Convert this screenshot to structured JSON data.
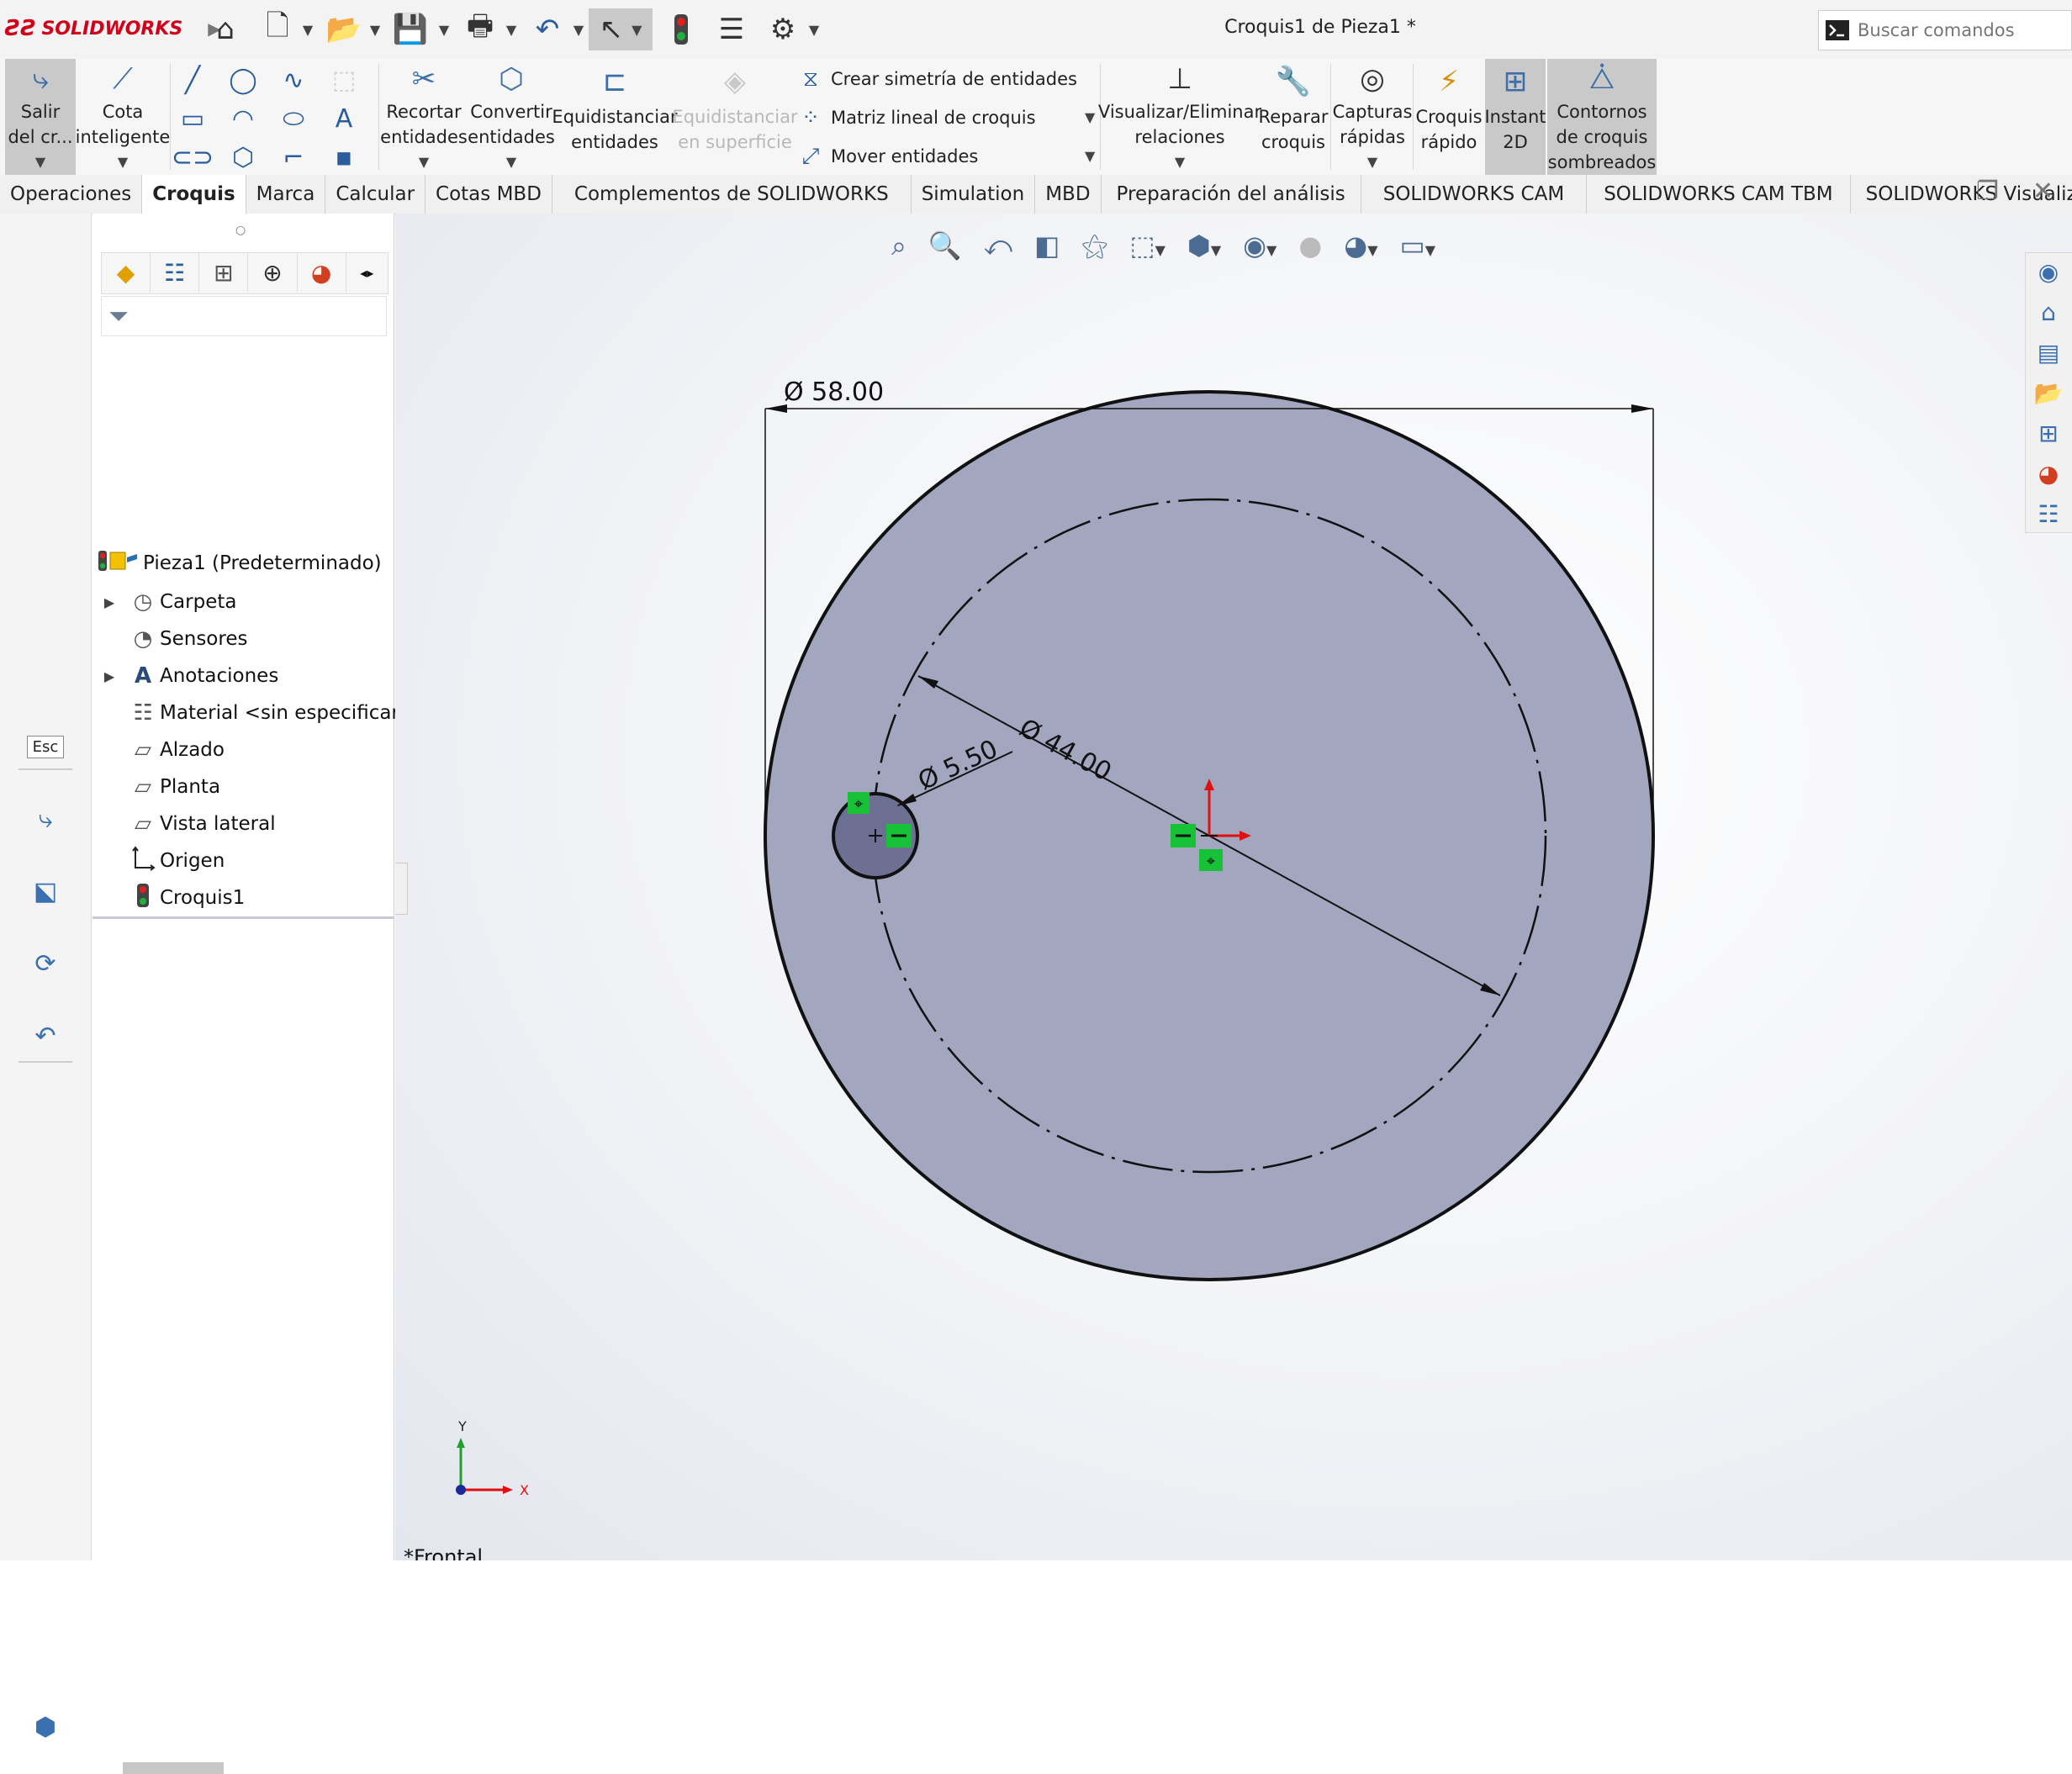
{
  "app": {
    "logo_text": "SOLIDWORKS",
    "doc_title": "Croquis1 de Pieza1 *"
  },
  "search": {
    "placeholder": "Buscar comandos"
  },
  "ribbon": {
    "exit_sketch": [
      "Salir",
      "del cr..."
    ],
    "smart_dimension": [
      "Cota",
      "inteligente"
    ],
    "trim": [
      "Recortar",
      "entidades"
    ],
    "convert": [
      "Convertir",
      "entidades"
    ],
    "offset": [
      "Equidistanciar",
      "entidades"
    ],
    "offset_surface": [
      "Equidistanciar",
      "en superficie"
    ],
    "mirror": "Crear simetría de entidades",
    "linear_pattern": "Matriz lineal de croquis",
    "move": "Mover entidades",
    "relations": [
      "Visualizar/Eliminar",
      "relaciones"
    ],
    "repair": [
      "Reparar",
      "croquis"
    ],
    "quick_snaps": [
      "Capturas",
      "rápidas"
    ],
    "rapid_sketch": [
      "Croquis",
      "rápido"
    ],
    "instant2d": [
      "Instant",
      "2D"
    ],
    "shaded_contours": [
      "Contornos",
      "de croquis",
      "sombreados"
    ]
  },
  "tabs": [
    "Operaciones",
    "Croquis",
    "Marca",
    "Calcular",
    "Cotas MBD",
    "Complementos de SOLIDWORKS",
    "Simulation",
    "MBD",
    "Preparación del análisis",
    "SOLIDWORKS CAM",
    "SOLIDWORKS CAM TBM",
    "SOLIDWORKS Visualize"
  ],
  "active_tab": "Croquis",
  "left_strip": {
    "esc_label": "Esc"
  },
  "tree": {
    "root": "Pieza1  (Predeterminado)",
    "items": [
      "Carpeta",
      "Sensores",
      "Anotaciones",
      "Material <sin especificar>",
      "Alzado",
      "Planta",
      "Vista lateral",
      "Origen",
      "Croquis1"
    ]
  },
  "sketch": {
    "dim_outer": "Ø 58.00",
    "dim_bolt_circle": "Ø 44.00",
    "dim_hole": "Ø 5.50",
    "triad_x": "X",
    "triad_y": "Y"
  },
  "view_label": "*Frontal",
  "colors": {
    "face_fill": "#a3a6bf",
    "relation_green": "#18c238",
    "origin_red": "#e01010",
    "accent": "#3a6fb0"
  }
}
